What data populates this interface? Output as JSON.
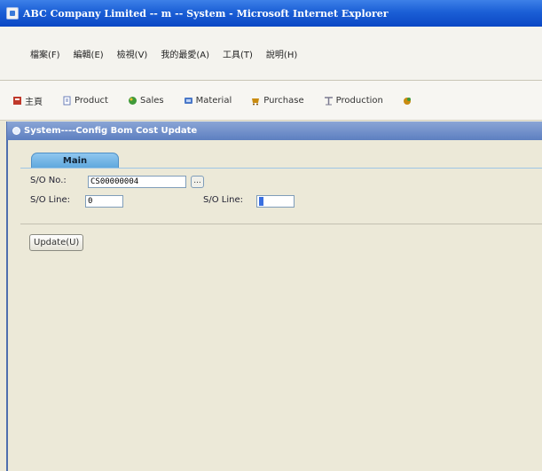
{
  "window": {
    "title": "ABC Company Limited -- m -- System - Microsoft Internet Explorer"
  },
  "menu": {
    "items": [
      "檔案(F)",
      "編輯(E)",
      "檢視(V)",
      "我的最愛(A)",
      "工具(T)",
      "說明(H)"
    ]
  },
  "nav": {
    "items": [
      {
        "label": "主頁",
        "icon": "home-icon",
        "color": "#c0392b"
      },
      {
        "label": "Product",
        "icon": "document-icon",
        "color": "#6b7fb8"
      },
      {
        "label": "Sales",
        "icon": "sales-icon",
        "color": "#3f9a3a"
      },
      {
        "label": "Material",
        "icon": "material-icon",
        "color": "#4a78c8"
      },
      {
        "label": "Purchase",
        "icon": "purchase-icon",
        "color": "#c98b10"
      },
      {
        "label": "Production",
        "icon": "production-icon",
        "color": "#7a7a90"
      }
    ]
  },
  "page": {
    "header": "System----Config Bom Cost Update"
  },
  "form": {
    "tab_label": "Main",
    "so_no_label": "S/O No.:",
    "so_no_value": "CS00000004",
    "lookup_label": "...",
    "so_line_from_label": "S/O Line:",
    "so_line_from_value": "0",
    "so_line_to_label": "S/O Line:",
    "so_line_to_value": "",
    "update_label": "Update(U)"
  }
}
